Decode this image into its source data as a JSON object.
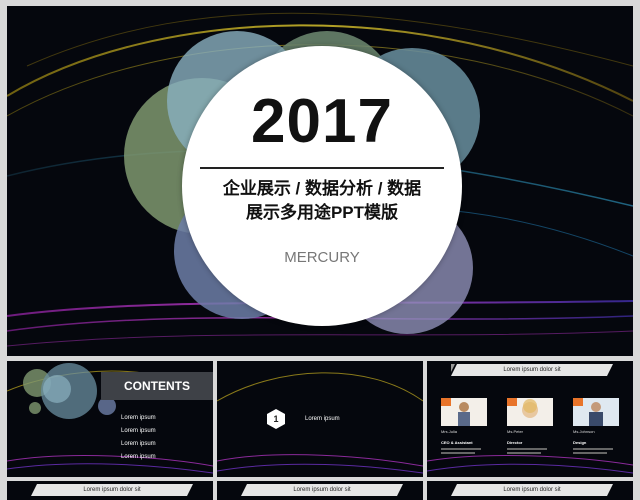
{
  "main_slide": {
    "year": "2017",
    "subtitle_line1": "企业展示 / 数据分析 / 数据",
    "subtitle_line2": "展示多用途PPT模版",
    "brand": "MERCURY"
  },
  "thumbs": {
    "contents": {
      "title": "CONTENTS",
      "items": [
        "Lorem ipsum",
        "Lorem ipsum",
        "Lorem ipsum",
        "Lorem ipsum"
      ]
    },
    "chapter": {
      "number": "1",
      "label": "Lorem ipsum"
    },
    "team": {
      "banner": "Lorem ipsum dolor sit",
      "members": [
        {
          "name": "Mrs.Julia",
          "role": "CEO & Assistant"
        },
        {
          "name": "Ms.Peter",
          "role": "Director"
        },
        {
          "name": "Ms.Johnson",
          "role": "Design"
        }
      ]
    },
    "bottom_banners": [
      "Lorem ipsum dolor sit",
      "Lorem ipsum dolor sit",
      "Lorem ipsum dolor sit"
    ]
  },
  "colors": {
    "background": "#05070d",
    "circle_green": "#7f9870",
    "circle_teal": "#6a8fa0",
    "circle_blue": "#6d7ea8",
    "circle_lavender": "#8f90b8",
    "accent_orange": "#e8742a"
  }
}
